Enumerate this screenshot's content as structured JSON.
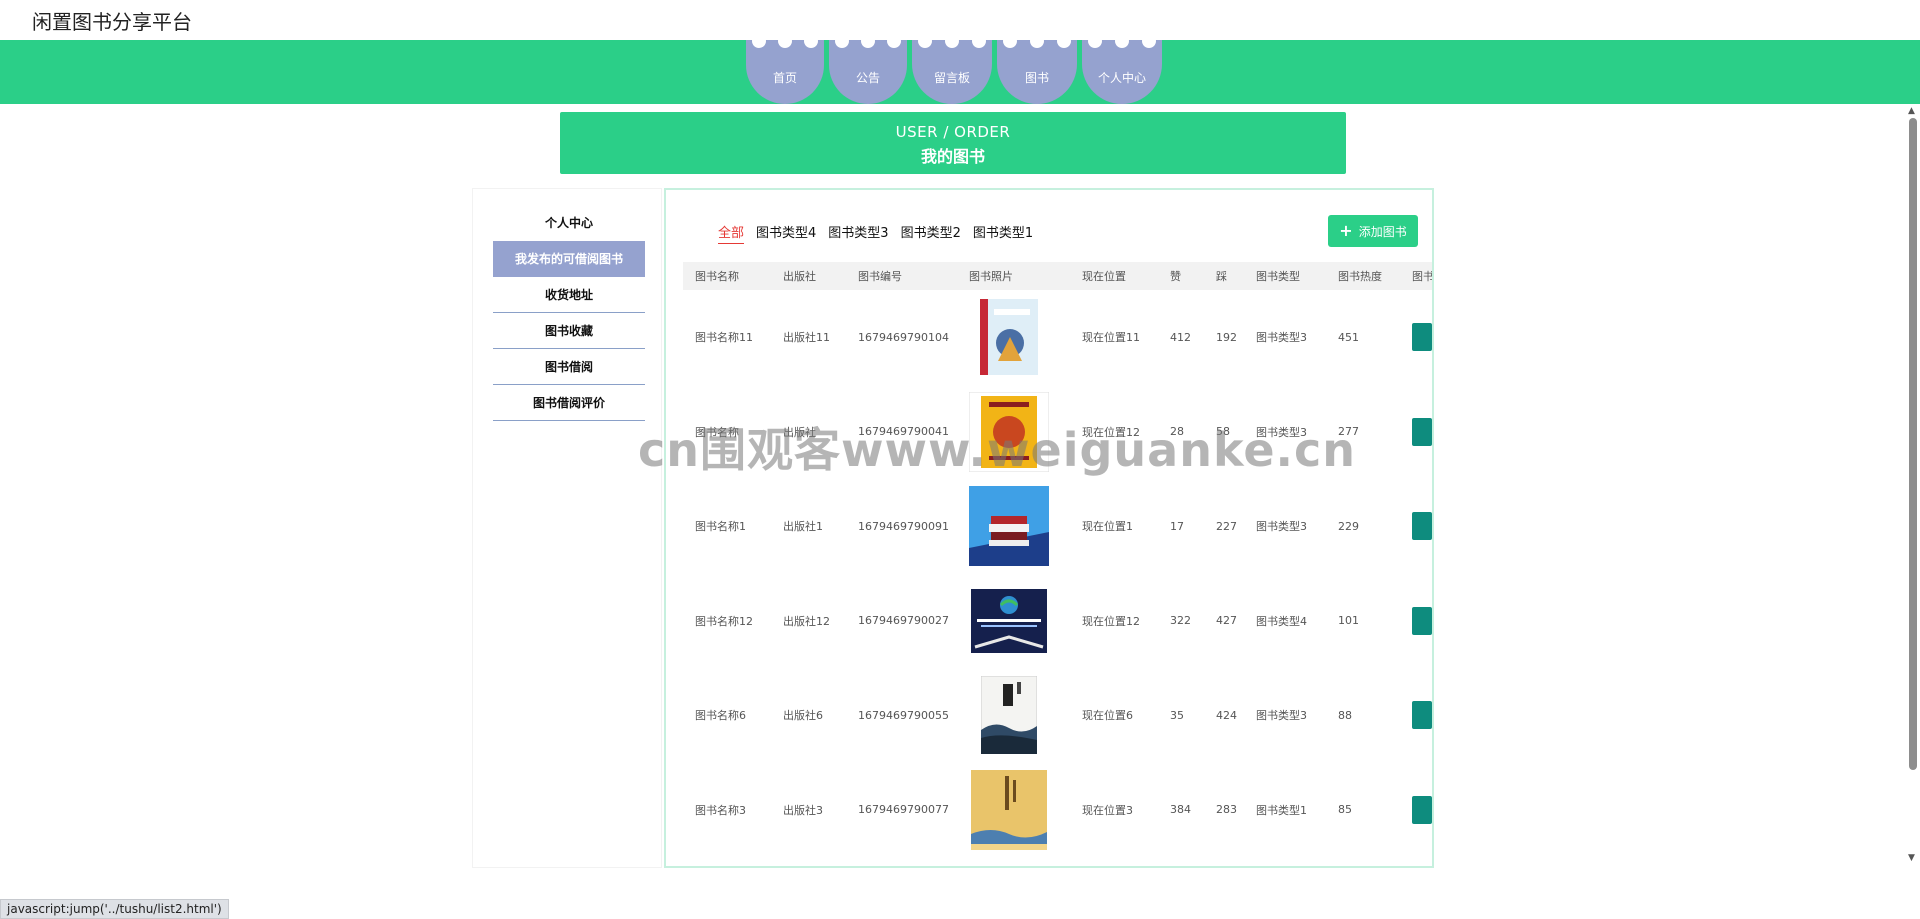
{
  "app": {
    "title": "闲置图书分享平台"
  },
  "nav": {
    "items": [
      "首页",
      "公告",
      "留言板",
      "图书",
      "个人中心"
    ]
  },
  "banner": {
    "en": "USER / ORDER",
    "cn": "我的图书"
  },
  "sidebar": {
    "items": [
      "个人中心",
      "我发布的可借阅图书",
      "收货地址",
      "图书收藏",
      "图书借阅",
      "图书借阅评价"
    ],
    "active_index": 1
  },
  "filters": {
    "items": [
      "全部",
      "图书类型4",
      "图书类型3",
      "图书类型2",
      "图书类型1"
    ],
    "active_index": 0
  },
  "add_button": {
    "label": "添加图书",
    "icon": "plus-icon"
  },
  "table": {
    "headers": [
      "图书名称",
      "出版社",
      "图书编号",
      "图书照片",
      "现在位置",
      "赞",
      "踩",
      "图书类型",
      "图书热度",
      "图书"
    ],
    "rows": [
      {
        "name": "图书名称11",
        "publisher": "出版社11",
        "code": "1679469790104",
        "position": "现在位置11",
        "likes": "412",
        "dislikes": "192",
        "type": "图书类型3",
        "hot": "451"
      },
      {
        "name": "图书名称",
        "publisher": "出版社",
        "code": "1679469790041",
        "position": "现在位置12",
        "likes": "28",
        "dislikes": "58",
        "type": "图书类型3",
        "hot": "277"
      },
      {
        "name": "图书名称1",
        "publisher": "出版社1",
        "code": "1679469790091",
        "position": "现在位置1",
        "likes": "17",
        "dislikes": "227",
        "type": "图书类型3",
        "hot": "229"
      },
      {
        "name": "图书名称12",
        "publisher": "出版社12",
        "code": "1679469790027",
        "position": "现在位置12",
        "likes": "322",
        "dislikes": "427",
        "type": "图书类型4",
        "hot": "101"
      },
      {
        "name": "图书名称6",
        "publisher": "出版社6",
        "code": "1679469790055",
        "position": "现在位置6",
        "likes": "35",
        "dislikes": "424",
        "type": "图书类型3",
        "hot": "88"
      },
      {
        "name": "图书名称3",
        "publisher": "出版社3",
        "code": "1679469790077",
        "position": "现在位置3",
        "likes": "384",
        "dislikes": "283",
        "type": "图书类型1",
        "hot": "85"
      }
    ]
  },
  "watermark": "cn围观客www.weiguanke.cn",
  "status_bar": "javascript:jump('../tushu/list2.html')",
  "colors": {
    "accent_green": "#2bcf88",
    "nav_purple": "#95a2cf",
    "action_teal": "#0e8c7e",
    "active_red": "#e53935"
  }
}
